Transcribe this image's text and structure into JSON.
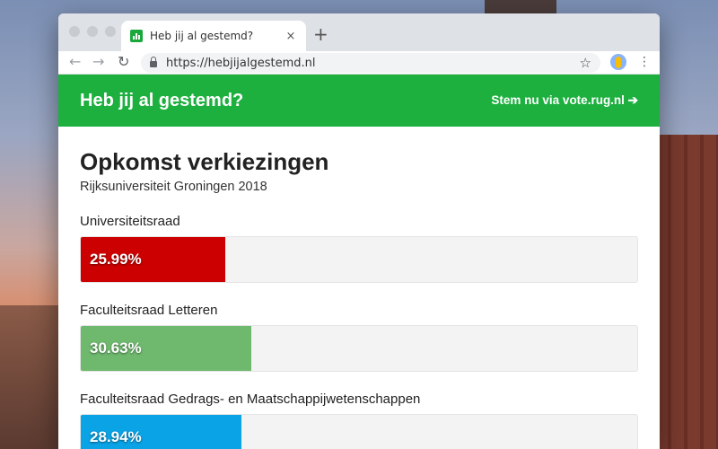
{
  "browser": {
    "tab_title": "Heb jij al gestemd?",
    "tab_close": "×",
    "new_tab": "+",
    "url": "https://hebjijalgestemd.nl",
    "back": "←",
    "forward": "→",
    "reload": "↻",
    "star": "☆",
    "menu": "⋮"
  },
  "header": {
    "title": "Heb jij al gestemd?",
    "cta": "Stem nu via vote.rug.nl ➔"
  },
  "main": {
    "title": "Opkomst verkiezingen",
    "subtitle": "Rijksuniversiteit Groningen 2018"
  },
  "turnout": [
    {
      "label": "Universiteitsraad",
      "percent_text": "25.99%",
      "value": 25.99,
      "color": "#cc0000"
    },
    {
      "label": "Faculteitsraad Letteren",
      "percent_text": "30.63%",
      "value": 30.63,
      "color": "#6fb96f"
    },
    {
      "label": "Faculteitsraad Gedrags- en Maatschappijwetenschappen",
      "percent_text": "28.94%",
      "value": 28.94,
      "color": "#0aa3e6"
    }
  ],
  "colors": {
    "header_green": "#1db03f"
  },
  "icons": {
    "favicon": "bar-chart-icon",
    "lock": "lock-icon",
    "star": "star-icon",
    "profile": "profile-icon"
  }
}
